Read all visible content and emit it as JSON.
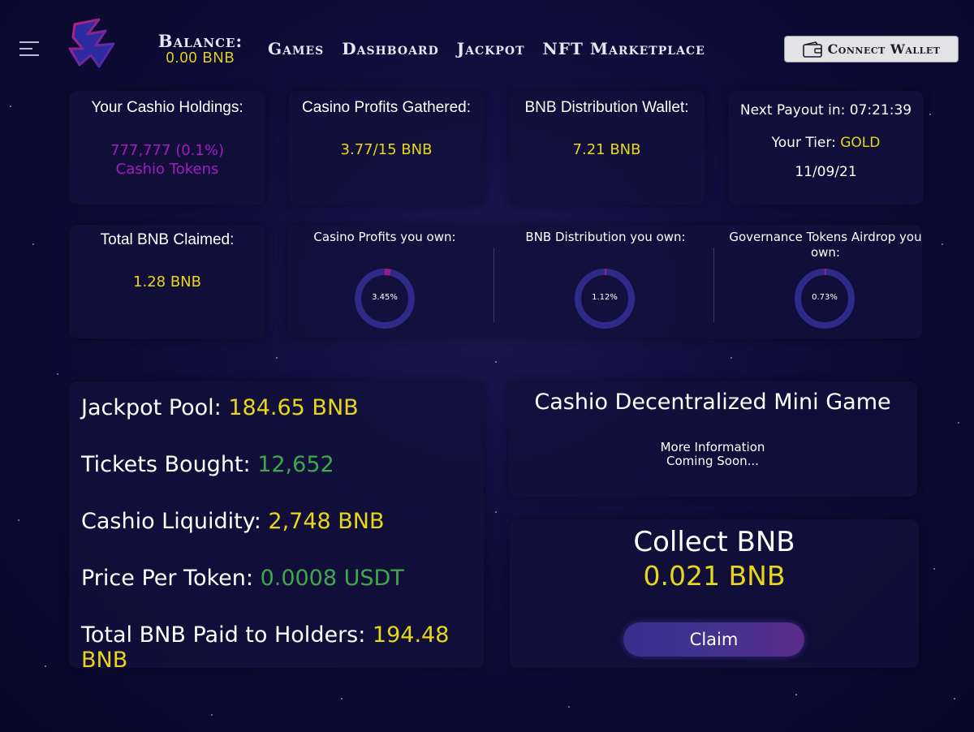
{
  "header": {
    "balance_label": "Balance:",
    "balance_value": "0.00 BNB",
    "nav": [
      "Games",
      "Dashboard",
      "Jackpot",
      "NFT Marketplace"
    ],
    "connect_label": "Connect Wallet"
  },
  "holdings": {
    "title": "Your Cashio Holdings:",
    "amount": "777,777 (0.1%)",
    "unit": "Cashio Tokens"
  },
  "casino_profits": {
    "title": "Casino Profits Gathered:",
    "value": "3.77/15 BNB"
  },
  "distribution_wallet": {
    "title": "BNB Distribution Wallet:",
    "value": "7.21 BNB"
  },
  "payout": {
    "next_label": "Next Payout in: ",
    "next_value": "07:21:39",
    "tier_label": "Your Tier:  ",
    "tier_value": "GOLD",
    "date": "11/09/21"
  },
  "claimed": {
    "title": "Total BNB Claimed:",
    "value": "1.28 BNB"
  },
  "ownership": [
    {
      "title": "Casino Profits you own:",
      "pct_label": "3.45%",
      "pct": 3.45
    },
    {
      "title": "BNB Distribution you own:",
      "pct_label": "1.12%",
      "pct": 1.12
    },
    {
      "title": "Governance Tokens Airdrop you own:",
      "pct_label": "0.73%",
      "pct": 0.73
    }
  ],
  "stats": {
    "jackpot_label": "Jackpot Pool: ",
    "jackpot_value": "184.65 BNB",
    "tickets_label": "Tickets Bought: ",
    "tickets_value": "12,652",
    "liquidity_label": "Cashio Liquidity: ",
    "liquidity_value": "2,748 BNB",
    "price_label": "Price Per Token:  ",
    "price_value": "0.0008 USDT",
    "paid_label": "Total BNB Paid to Holders: ",
    "paid_value": "194.48 BNB"
  },
  "minigame": {
    "title": "Cashio Decentralized Mini Game",
    "line1": "More Information",
    "line2": "Coming Soon..."
  },
  "collect": {
    "title": "Collect BNB",
    "amount": "0.021 BNB",
    "button": "Claim"
  },
  "colors": {
    "accent_yellow": "#e7d71a",
    "accent_green": "#3fa84a",
    "accent_purple": "#a11dc1",
    "donut_ring": "#2e2a88",
    "donut_fill": "#9a1a8c"
  }
}
